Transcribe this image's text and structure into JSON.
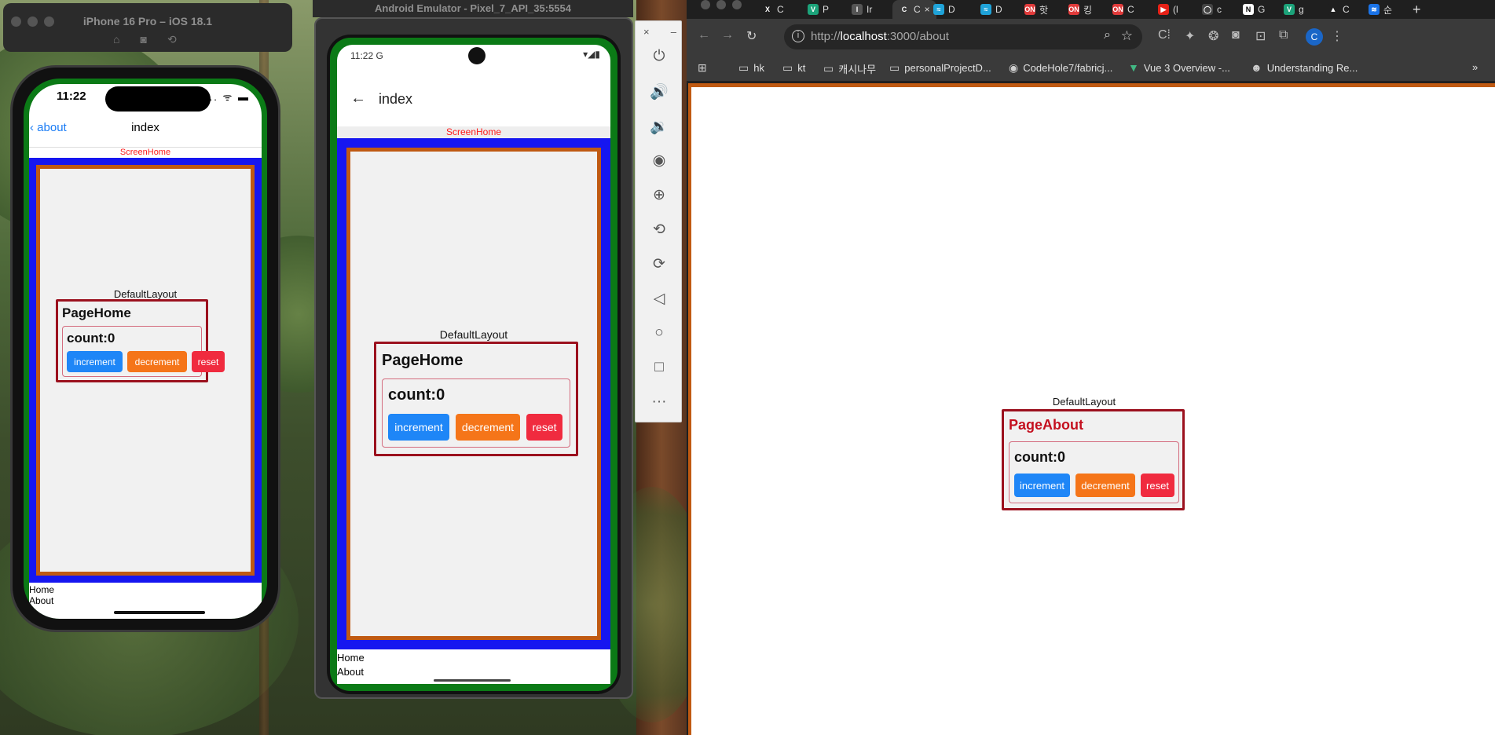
{
  "ios_simulator": {
    "window_title": "iPhone 16 Pro – iOS 18.1",
    "tool_icons": [
      "home-icon",
      "screenshot-icon",
      "rotate-icon"
    ],
    "status_time": "11:22",
    "status_icons": ".... ᯤ ▬",
    "nav_back_label": "about",
    "nav_title": "index",
    "screen_label": "ScreenHome",
    "layout_label": "DefaultLayout",
    "page_title": "PageHome",
    "count_text": "count:0",
    "buttons": {
      "increment": "increment",
      "decrement": "decrement",
      "reset": "reset"
    },
    "tab_links": [
      "Home",
      "About"
    ]
  },
  "android_emulator": {
    "window_title": "Android Emulator - Pixel_7_API_35:5554",
    "status_time": "11:22 G",
    "status_icons": "▾◢▮",
    "appbar_back": "←",
    "appbar_title": "index",
    "screen_label": "ScreenHome",
    "layout_label": "DefaultLayout",
    "page_title": "PageHome",
    "count_text": "count:0",
    "buttons": {
      "increment": "increment",
      "decrement": "decrement",
      "reset": "reset"
    },
    "tab_links": [
      "Home",
      "About"
    ],
    "panel_controls": {
      "close": "×",
      "minimize": "–"
    },
    "panel_tools": [
      "power-icon",
      "volume-up-icon",
      "volume-down-icon",
      "camera-icon",
      "zoom-icon",
      "rotate-left-icon",
      "rotate-right-icon",
      "back-icon",
      "home-icon",
      "overview-icon",
      "more-icon"
    ]
  },
  "browser": {
    "tabs": [
      {
        "favicon": "X",
        "label": "C",
        "color": "#1f1f1f"
      },
      {
        "favicon": "V",
        "label": "P",
        "color": "#1ca37a"
      },
      {
        "favicon": "I",
        "label": "Ir",
        "color": "#555555"
      },
      {
        "favicon": "C",
        "label": "C",
        "color": "#3a3a3a"
      },
      {
        "favicon": "≈",
        "label": "D",
        "color": "#1fa3d9"
      },
      {
        "favicon": "≈",
        "label": "D",
        "color": "#1fa3d9"
      },
      {
        "favicon": "ON",
        "label": "핫",
        "color": "#e23b3b"
      },
      {
        "favicon": "ON",
        "label": "킹",
        "color": "#e23b3b"
      },
      {
        "favicon": "ON",
        "label": "C",
        "color": "#e23b3b"
      },
      {
        "favicon": "▶",
        "label": "(l",
        "color": "#e62117"
      },
      {
        "favicon": "◯",
        "label": "c",
        "color": "#444444"
      },
      {
        "favicon": "N",
        "label": "G",
        "color": "#ffffff"
      },
      {
        "favicon": "V",
        "label": "g",
        "color": "#1ca37a"
      },
      {
        "favicon": "▲",
        "label": "C",
        "color": "#1f1f1f"
      },
      {
        "favicon": "≋",
        "label": "순",
        "color": "#1a73e8"
      }
    ],
    "active_tab_index": 3,
    "new_tab": "+",
    "url_host": "localhost",
    "url_prefix": "http://",
    "url_rest": ":3000/about",
    "profile_initial": "C",
    "bookmarks": [
      {
        "icon": "folder-icon",
        "label": "hk"
      },
      {
        "icon": "folder-icon",
        "label": "kt"
      },
      {
        "icon": "folder-icon",
        "label": "캐시나무"
      },
      {
        "icon": "folder-icon",
        "label": "personalProjectD..."
      },
      {
        "icon": "github-icon",
        "label": "CodeHole7/fabricj..."
      },
      {
        "icon": "vue-icon",
        "label": "Vue 3 Overview -..."
      },
      {
        "icon": "avatar-icon",
        "label": "Understanding Re..."
      }
    ],
    "bookmarks_overflow": "»",
    "page": {
      "layout_label": "DefaultLayout",
      "page_title": "PageAbout",
      "count_text": "count:0",
      "buttons": {
        "increment": "increment",
        "decrement": "decrement",
        "reset": "reset"
      }
    }
  }
}
